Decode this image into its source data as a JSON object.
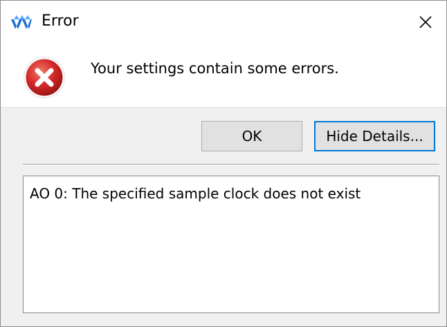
{
  "window": {
    "title": "Error",
    "app_icon": "app-logo-icon",
    "close_icon": "close-icon"
  },
  "message": {
    "icon": "error-icon",
    "text": "Your settings contain some errors."
  },
  "buttons": {
    "ok_label": "OK",
    "details_label": "Hide Details..."
  },
  "details": {
    "text": "AO 0: The specified sample clock does not exist"
  },
  "colors": {
    "accent": "#0078d7",
    "error_red": "#d42a2a",
    "logo_blue": "#1f6fd1"
  }
}
